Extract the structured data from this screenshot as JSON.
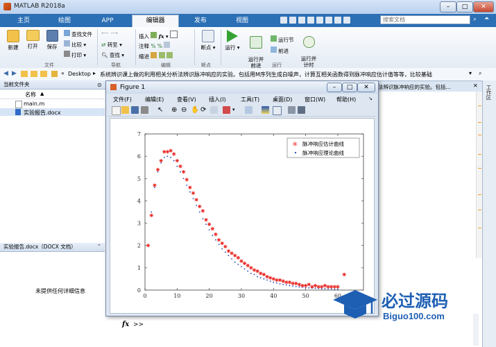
{
  "app": {
    "title": "MATLAB R2018a"
  },
  "tabs": [
    "主页",
    "绘图",
    "APP",
    "编辑器",
    "发布",
    "视图"
  ],
  "active_tab": "编辑器",
  "search": {
    "placeholder": "搜索文档"
  },
  "ribbon": {
    "file": {
      "new": "新建",
      "open": "打开",
      "save": "保存",
      "find_files": "查找文件",
      "compare": "比较",
      "print": "打印",
      "group": "文件"
    },
    "nav": {
      "goto": "转至",
      "find": "查找",
      "group": "导航"
    },
    "edit": {
      "insert": "插入",
      "comment": "注释",
      "indent": "缩进",
      "fx": "fx",
      "group": "编辑"
    },
    "breakpoints": {
      "label": "断点",
      "group": "断点"
    },
    "run": {
      "run": "运行",
      "run_advance": "运行并\n前进",
      "run_section": "运行节",
      "advance": "前进",
      "run_time": "运行并\n计时",
      "group": "运行"
    }
  },
  "address": {
    "path_prefix": "«",
    "path_desktop": "Desktop",
    "path_tail": "系统辨识课上做的利用相关分析法辨识脉冲响应的实验。包括用M序列生成白噪声，计算互相关函数得到脉冲响应估计值等等，比较基础"
  },
  "left": {
    "current_folder": "当前文件夹",
    "col_name": "名称",
    "files": [
      "main.m",
      "实验报告.docx"
    ],
    "detail_title": "实验报告.docx（DOCX 文档）",
    "detail_msg": "未提供任何详细信息"
  },
  "right_strip": {
    "label": "工作区"
  },
  "bg_editor_tail": "法辨识脉冲响应的实验。包括...",
  "cmd": {
    "fx": "fx",
    "prompt": ">>"
  },
  "figure": {
    "title": "Figure 1",
    "menu": [
      "文件(F)",
      "编辑(E)",
      "查看(V)",
      "插入(I)",
      "工具(T)",
      "桌面(D)",
      "窗口(W)",
      "帮助(H)"
    ]
  },
  "watermark": {
    "text": "必过源码",
    "url": "Biguo100.com"
  },
  "colors": {
    "tabbar": "#2b6fb5",
    "series_est": "#e8231f",
    "series_theory": "#1f3fb5"
  },
  "chart_data": {
    "type": "scatter",
    "x_ticks": [
      0,
      10,
      20,
      30,
      40,
      50,
      60
    ],
    "y_ticks": [
      0,
      1,
      2,
      3,
      4,
      5,
      6,
      7
    ],
    "xlim": [
      0,
      68
    ],
    "ylim": [
      0,
      7
    ],
    "legend_position": "top-right",
    "series": [
      {
        "name": "脉冲响应估计曲线",
        "marker": "star",
        "color": "#e8231f",
        "points": [
          [
            1,
            2.0
          ],
          [
            2,
            3.35
          ],
          [
            3,
            4.7
          ],
          [
            4,
            5.4
          ],
          [
            5,
            5.8
          ],
          [
            6,
            6.2
          ],
          [
            7,
            6.2
          ],
          [
            8,
            6.25
          ],
          [
            9,
            6.1
          ],
          [
            10,
            5.8
          ],
          [
            11,
            5.55
          ],
          [
            12,
            5.3
          ],
          [
            13,
            4.95
          ],
          [
            14,
            4.6
          ],
          [
            15,
            4.35
          ],
          [
            16,
            4.05
          ],
          [
            17,
            3.75
          ],
          [
            18,
            3.55
          ],
          [
            19,
            3.15
          ],
          [
            20,
            2.95
          ],
          [
            21,
            2.75
          ],
          [
            22,
            2.5
          ],
          [
            23,
            2.25
          ],
          [
            24,
            2.1
          ],
          [
            25,
            1.95
          ],
          [
            26,
            1.75
          ],
          [
            27,
            1.65
          ],
          [
            28,
            1.55
          ],
          [
            29,
            1.45
          ],
          [
            30,
            1.3
          ],
          [
            31,
            1.2
          ],
          [
            32,
            1.1
          ],
          [
            33,
            1.0
          ],
          [
            34,
            0.9
          ],
          [
            35,
            0.85
          ],
          [
            36,
            0.75
          ],
          [
            37,
            0.7
          ],
          [
            38,
            0.6
          ],
          [
            39,
            0.55
          ],
          [
            40,
            0.5
          ],
          [
            41,
            0.45
          ],
          [
            42,
            0.45
          ],
          [
            43,
            0.4
          ],
          [
            44,
            0.35
          ],
          [
            45,
            0.35
          ],
          [
            46,
            0.3
          ],
          [
            47,
            0.3
          ],
          [
            48,
            0.25
          ],
          [
            49,
            0.2
          ],
          [
            50,
            0.2
          ],
          [
            51,
            0.25
          ],
          [
            52,
            0.15
          ],
          [
            53,
            0.2
          ],
          [
            54,
            0.15
          ],
          [
            55,
            0.15
          ],
          [
            56,
            0.2
          ],
          [
            57,
            0.15
          ],
          [
            58,
            0.15
          ],
          [
            59,
            0.15
          ],
          [
            60,
            0.15
          ],
          [
            62,
            0.7
          ]
        ]
      },
      {
        "name": "脉冲响应理论曲线",
        "marker": "dot",
        "color": "#1f3fb5",
        "points": [
          [
            1,
            2.0
          ],
          [
            2,
            3.5
          ],
          [
            3,
            4.6
          ],
          [
            4,
            5.3
          ],
          [
            5,
            5.7
          ],
          [
            6,
            5.95
          ],
          [
            7,
            6.0
          ],
          [
            8,
            5.95
          ],
          [
            9,
            5.8
          ],
          [
            10,
            5.55
          ],
          [
            11,
            5.3
          ],
          [
            12,
            5.0
          ],
          [
            13,
            4.7
          ],
          [
            14,
            4.4
          ],
          [
            15,
            4.1
          ],
          [
            16,
            3.8
          ],
          [
            17,
            3.5
          ],
          [
            18,
            3.2
          ],
          [
            19,
            2.95
          ],
          [
            20,
            2.7
          ],
          [
            21,
            2.45
          ],
          [
            22,
            2.25
          ],
          [
            23,
            2.05
          ],
          [
            24,
            1.85
          ],
          [
            25,
            1.7
          ],
          [
            26,
            1.55
          ],
          [
            27,
            1.4
          ],
          [
            28,
            1.25
          ],
          [
            29,
            1.15
          ],
          [
            30,
            1.05
          ],
          [
            31,
            0.95
          ],
          [
            32,
            0.85
          ],
          [
            33,
            0.75
          ],
          [
            34,
            0.7
          ],
          [
            35,
            0.6
          ],
          [
            36,
            0.55
          ],
          [
            37,
            0.5
          ],
          [
            38,
            0.45
          ],
          [
            39,
            0.4
          ],
          [
            40,
            0.35
          ],
          [
            41,
            0.32
          ],
          [
            42,
            0.28
          ],
          [
            43,
            0.25
          ],
          [
            44,
            0.23
          ],
          [
            45,
            0.2
          ],
          [
            46,
            0.18
          ],
          [
            47,
            0.16
          ],
          [
            48,
            0.14
          ],
          [
            49,
            0.13
          ],
          [
            50,
            0.11
          ],
          [
            51,
            0.1
          ],
          [
            52,
            0.09
          ],
          [
            53,
            0.08
          ],
          [
            54,
            0.07
          ],
          [
            55,
            0.06
          ],
          [
            56,
            0.06
          ],
          [
            57,
            0.05
          ],
          [
            58,
            0.05
          ],
          [
            59,
            0.04
          ],
          [
            60,
            0.04
          ]
        ]
      }
    ]
  }
}
